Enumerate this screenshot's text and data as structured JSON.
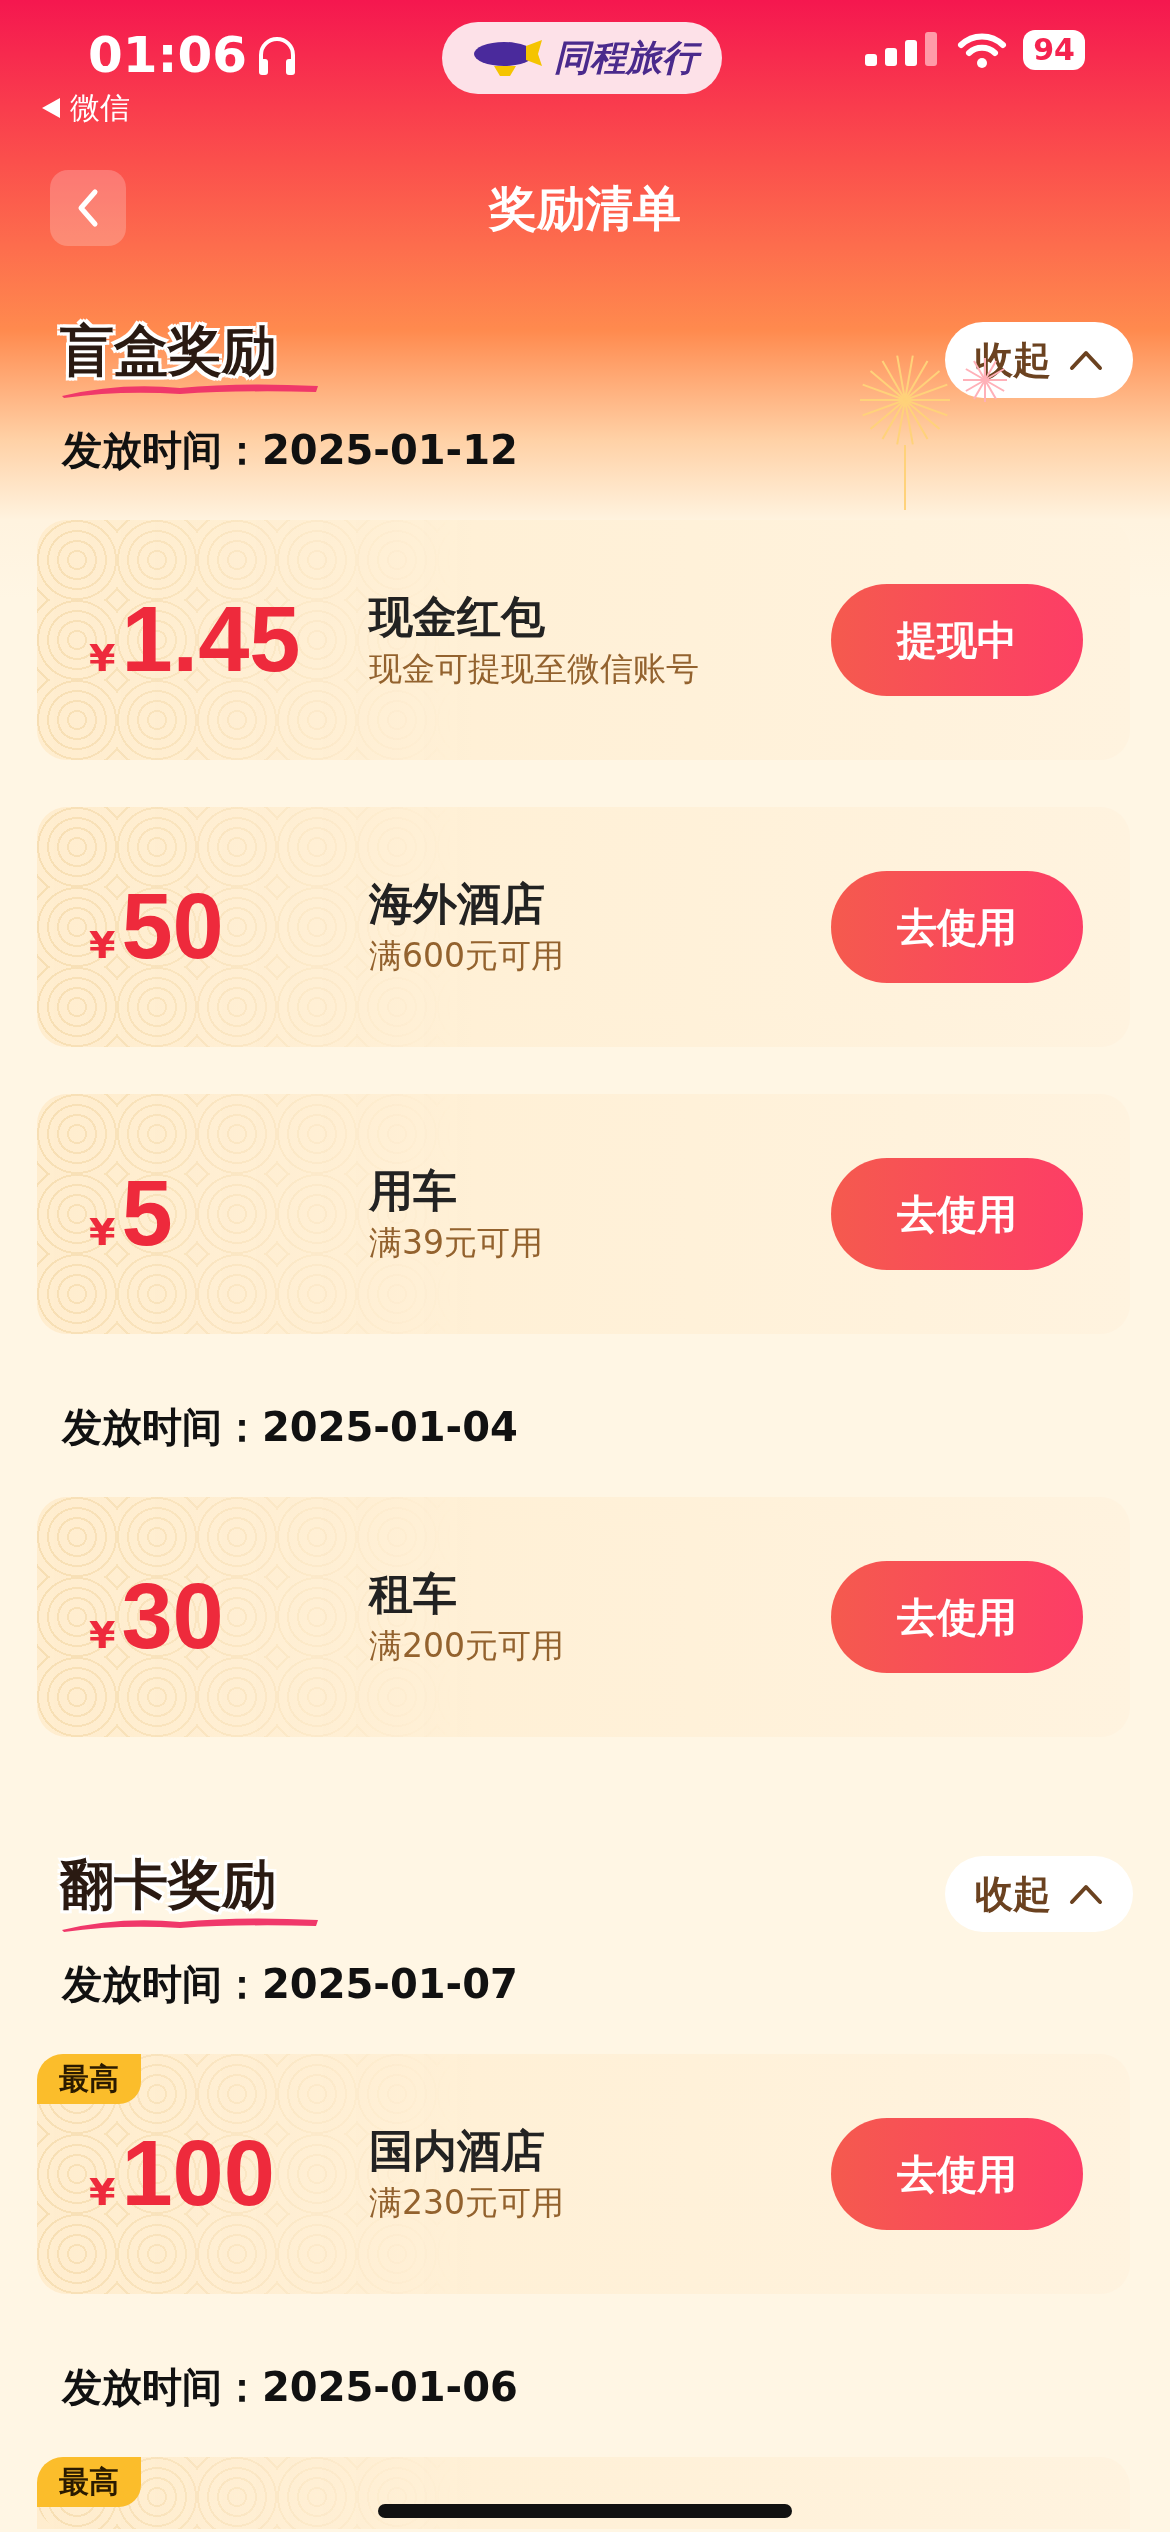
{
  "status_bar": {
    "time": "01:06",
    "back_app": "微信",
    "battery": "94"
  },
  "app_badge": {
    "label": "同程旅行"
  },
  "header": {
    "title": "奖励清单"
  },
  "sections": [
    {
      "title": "盲盒奖励",
      "toggle": "收起",
      "expanded": true,
      "groups": [
        {
          "date_label": "发放时间：2025-01-12",
          "rewards": [
            {
              "currency": "¥",
              "amount": "1.45",
              "name": "现金红包",
              "condition": "现金可提现至微信账号",
              "action": "提现中"
            },
            {
              "currency": "¥",
              "amount": "50",
              "name": "海外酒店",
              "condition": "满600元可用",
              "action": "去使用"
            },
            {
              "currency": "¥",
              "amount": "5",
              "name": "用车",
              "condition": "满39元可用",
              "action": "去使用"
            }
          ]
        },
        {
          "date_label": "发放时间：2025-01-04",
          "rewards": [
            {
              "currency": "¥",
              "amount": "30",
              "name": "租车",
              "condition": "满200元可用",
              "action": "去使用"
            }
          ]
        }
      ]
    },
    {
      "title": "翻卡奖励",
      "toggle": "收起",
      "expanded": true,
      "groups": [
        {
          "date_label": "发放时间：2025-01-07",
          "rewards": [
            {
              "tag": "最高",
              "currency": "¥",
              "amount": "100",
              "name": "国内酒店",
              "condition": "满230元可用",
              "action": "去使用"
            }
          ]
        },
        {
          "date_label": "发放时间：2025-01-06",
          "rewards": [
            {
              "tag": "最高"
            }
          ]
        }
      ]
    }
  ]
}
